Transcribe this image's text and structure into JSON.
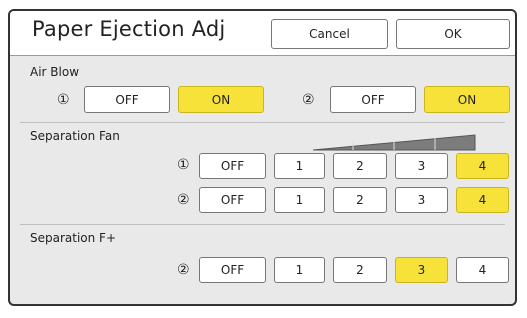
{
  "title": "Paper Ejection Adj",
  "buttons": {
    "cancel": "Cancel",
    "ok": "OK"
  },
  "air_blow": {
    "label": "Air Blow",
    "unit1": {
      "marker": "①",
      "off": "OFF",
      "on": "ON",
      "selected": "ON"
    },
    "unit2": {
      "marker": "②",
      "off": "OFF",
      "on": "ON",
      "selected": "ON"
    }
  },
  "separation_fan": {
    "label": "Separation Fan",
    "row1": {
      "marker": "①",
      "options": [
        "OFF",
        "1",
        "2",
        "3",
        "4"
      ],
      "selected": "4"
    },
    "row2": {
      "marker": "②",
      "options": [
        "OFF",
        "1",
        "2",
        "3",
        "4"
      ],
      "selected": "4"
    }
  },
  "separation_fplus": {
    "label": "Separation F+",
    "row": {
      "marker": "②",
      "options": [
        "OFF",
        "1",
        "2",
        "3",
        "4"
      ],
      "selected": "3"
    }
  },
  "colors": {
    "selected": "#f7e23a",
    "normal": "#ffffff",
    "panel": "#e9e9e9"
  }
}
